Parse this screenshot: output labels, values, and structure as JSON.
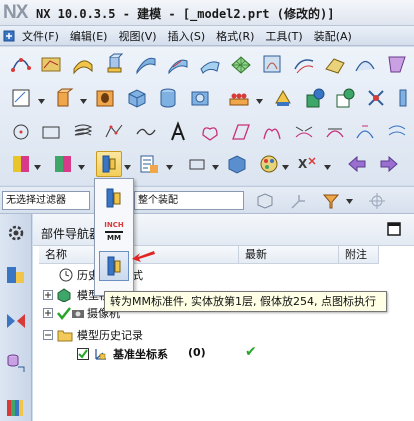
{
  "app": {
    "logo": "NX",
    "title": "NX 10.0.3.5 - 建模 - [_model2.prt (修改的)]"
  },
  "menu": [
    {
      "label": "文件(F)"
    },
    {
      "label": "编辑(E)"
    },
    {
      "label": "视图(V)"
    },
    {
      "label": "插入(S)"
    },
    {
      "label": "格式(R)"
    },
    {
      "label": "工具(T)"
    },
    {
      "label": "装配(A)"
    }
  ],
  "filterbar": {
    "filter_value": "无选择过滤器",
    "scope_value": "整个装配"
  },
  "dropdown": {
    "inch_mm_label_top": "INCH",
    "inch_mm_label_bottom": "MM"
  },
  "navigator": {
    "title": "部件导航器",
    "columns": {
      "name": "名称",
      "latest": "最新",
      "note": "附注"
    },
    "rows": [
      {
        "label": "历史记录模式"
      },
      {
        "label": "模型视图"
      },
      {
        "label": "摄像机"
      },
      {
        "label": "模型历史记录"
      },
      {
        "label": "基准坐标系",
        "status": "(0)",
        "latest": "✔"
      }
    ]
  },
  "tooltip": {
    "text": "转为MM标准件, 实体放第1层, 假体放254, 点图标执行"
  },
  "colors": {
    "accent": "#2e6fbf",
    "arrow_red": "#e02424",
    "check_green": "#28a428"
  }
}
